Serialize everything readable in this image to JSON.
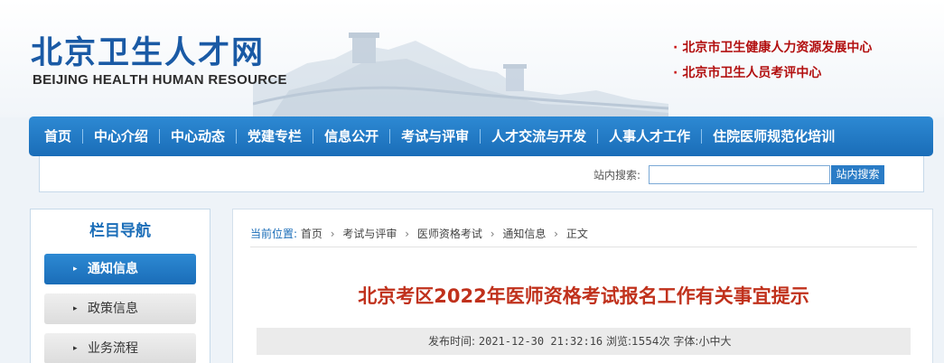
{
  "header": {
    "logo_cn": "北京卫生人才网",
    "logo_en": "BEIJING HEALTH HUMAN RESOURCE",
    "centers": [
      "北京市卫生健康人力资源发展中心",
      "北京市卫生人员考评中心"
    ]
  },
  "nav": {
    "items": [
      "首页",
      "中心介绍",
      "中心动态",
      "党建专栏",
      "信息公开",
      "考试与评审",
      "人才交流与开发",
      "人事人才工作",
      "住院医师规范化培训"
    ]
  },
  "search": {
    "label": "站内搜索:",
    "value": "",
    "button": "站内搜索"
  },
  "sidebar": {
    "title": "栏目导航",
    "items": [
      "通知信息",
      "政策信息",
      "业务流程"
    ]
  },
  "breadcrumb": {
    "label": "当前位置:",
    "items": [
      "首页",
      "考试与评审",
      "医师资格考试",
      "通知信息",
      "正文"
    ]
  },
  "article": {
    "title": "北京考区2022年医师资格考试报名工作有关事宜提示",
    "publish_label": "发布时间:",
    "publish_time": "2021-12-30 21:32:16",
    "views_label": "浏览:",
    "views": "1554次",
    "font_label": "字体:",
    "font_sizes": [
      "小",
      "中",
      "大"
    ]
  },
  "colors": {
    "brand_blue": "#1a6db8",
    "title_red": "#c0311c",
    "center_link_red": "#b20f0f"
  }
}
